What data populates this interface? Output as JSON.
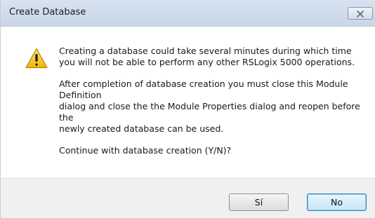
{
  "window": {
    "title": "Create Database",
    "close_icon": "close-icon"
  },
  "message": {
    "icon": "warning-icon",
    "paragraph1": [
      "Creating a database could take several minutes during which time",
      "you will not be able to perform any other RSLogix 5000 operations."
    ],
    "paragraph2": [
      "After completion of database creation you must close this Module",
      "Definition",
      "dialog and close the the Module Properties dialog and reopen before",
      "the",
      "newly created database can be used."
    ],
    "paragraph3": [
      "Continue with database creation (Y/N)?"
    ]
  },
  "buttons": {
    "yes_label": "Sí",
    "no_label": "No"
  },
  "colors": {
    "titlebar": "#c8d6e8",
    "warning_fill": "#f5c518",
    "default_button_border": "#3c7fb1"
  }
}
